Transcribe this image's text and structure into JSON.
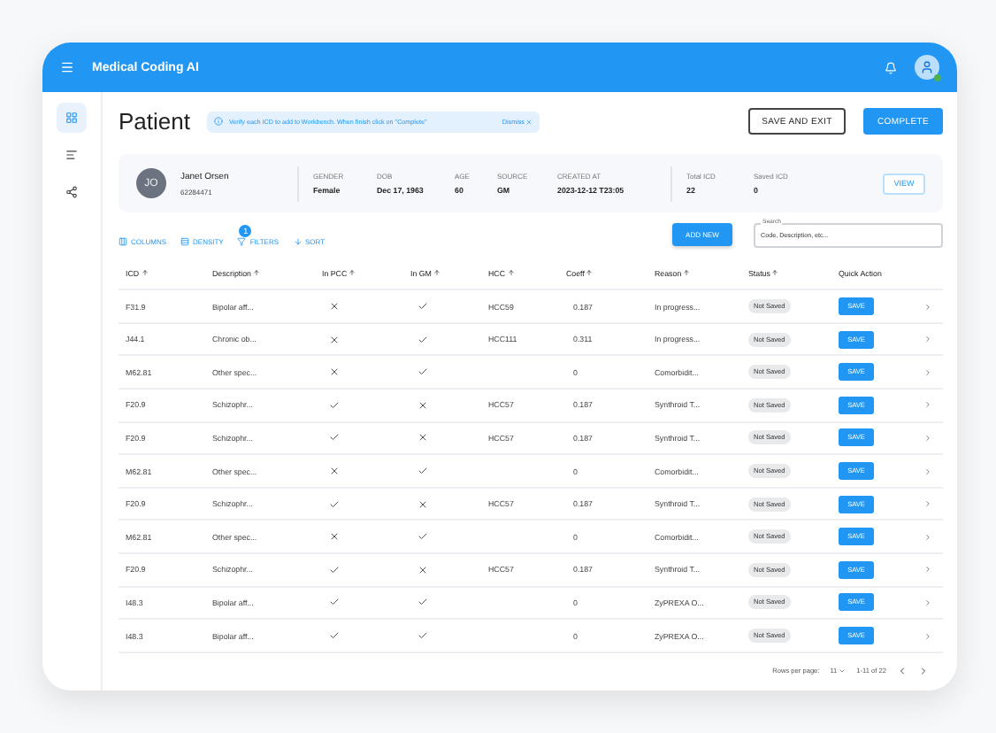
{
  "app_bar": {
    "title": "Medical Coding AI",
    "user_online": true
  },
  "sidebar": {
    "items": [
      {
        "selected": true
      },
      {
        "selected": false
      },
      {
        "selected": false
      }
    ]
  },
  "page": {
    "title": "Patient",
    "notice": {
      "text": "Verify each ICD to add to Workbench. When finish click on \"Complete\"",
      "action": "Dismiss"
    },
    "buttons": [
      {
        "label": "SAVE AND EXIT",
        "kind": "outlined"
      },
      {
        "label": "COMPLETE",
        "kind": "contained"
      }
    ]
  },
  "patient": {
    "initials": "JO",
    "name": "Janet Orsen",
    "id": "62284471",
    "fields": [
      {
        "label": "GENDER",
        "value": "Female"
      },
      {
        "label": "DOB",
        "value": "Dec 17, 1963"
      },
      {
        "label": "AGE",
        "value": "60"
      },
      {
        "label": "SOURCE",
        "value": "GM"
      },
      {
        "label": "CREATED AT",
        "value": "2023-12-12 T23:05"
      }
    ],
    "stats": [
      {
        "label": "Total ICD",
        "value": "22"
      },
      {
        "label": "Saved ICD",
        "value": "0"
      }
    ],
    "view_button": "VIEW"
  },
  "toolbar": {
    "items": [
      {
        "label": "COLUMNS"
      },
      {
        "label": "DENSITY"
      },
      {
        "label": "FILTERS",
        "badge": "1"
      },
      {
        "label": "SORT"
      }
    ],
    "add_button": "ADD NEW",
    "search": {
      "label": "Search",
      "placeholder": "Code, Description, etc..."
    }
  },
  "table": {
    "columns": [
      "ICD",
      "Description",
      "In PCC",
      "In GM",
      "HCC",
      "Coeff",
      "Reason",
      "Status",
      "Quick Action"
    ],
    "rows": [
      {
        "icd": "F31.9",
        "description": "Bipolar aff...",
        "in_pcc": false,
        "in_gm": true,
        "hcc": "HCC59",
        "coeff": "0.187",
        "reason": "In progress...",
        "status": "Not Saved",
        "action": "SAVE"
      },
      {
        "icd": "J44.1",
        "description": "Chronic ob...",
        "in_pcc": false,
        "in_gm": true,
        "hcc": "HCC111",
        "coeff": "0.311",
        "reason": "In progress...",
        "status": "Not Saved",
        "action": "SAVE"
      },
      {
        "icd": "M62.81",
        "description": "Other spec...",
        "in_pcc": false,
        "in_gm": true,
        "coeff": "0",
        "reason": "Comorbidit...",
        "status": "Not Saved",
        "action": "SAVE"
      },
      {
        "icd": "F20.9",
        "description": "Schizophr...",
        "in_pcc": true,
        "in_gm": false,
        "hcc": "HCC57",
        "coeff": "0.187",
        "reason": "Synthroid T...",
        "status": "Not Saved",
        "action": "SAVE"
      },
      {
        "icd": "F20.9",
        "description": "Schizophr...",
        "in_pcc": true,
        "in_gm": false,
        "hcc": "HCC57",
        "coeff": "0.187",
        "reason": "Synthroid T...",
        "status": "Not Saved",
        "action": "SAVE"
      },
      {
        "icd": "M62.81",
        "description": "Other spec...",
        "in_pcc": false,
        "in_gm": true,
        "coeff": "0",
        "reason": "Comorbidit...",
        "status": "Not Saved",
        "action": "SAVE"
      },
      {
        "icd": "F20.9",
        "description": "Schizophr...",
        "in_pcc": true,
        "in_gm": false,
        "hcc": "HCC57",
        "coeff": "0.187",
        "reason": "Synthroid T...",
        "status": "Not Saved",
        "action": "SAVE"
      },
      {
        "icd": "M62.81",
        "description": "Other spec...",
        "in_pcc": false,
        "in_gm": true,
        "coeff": "0",
        "reason": "Comorbidit...",
        "status": "Not Saved",
        "action": "SAVE"
      },
      {
        "icd": "F20.9",
        "description": "Schizophr...",
        "in_pcc": true,
        "in_gm": false,
        "hcc": "HCC57",
        "coeff": "0.187",
        "reason": "Synthroid T...",
        "status": "Not Saved",
        "action": "SAVE"
      },
      {
        "icd": "I48.3",
        "description": "Bipolar aff...",
        "in_pcc": true,
        "in_gm": true,
        "coeff": "0",
        "reason": "ZyPREXA O...",
        "status": "Not Saved",
        "action": "SAVE"
      },
      {
        "icd": "I48.3",
        "description": "Bipolar aff...",
        "in_pcc": true,
        "in_gm": true,
        "coeff": "0",
        "reason": "ZyPREXA O...",
        "status": "Not Saved",
        "action": "SAVE"
      }
    ]
  },
  "pagination": {
    "rows_label": "Rows per page:",
    "rows_value": "11",
    "range": "1-11 of 22"
  }
}
